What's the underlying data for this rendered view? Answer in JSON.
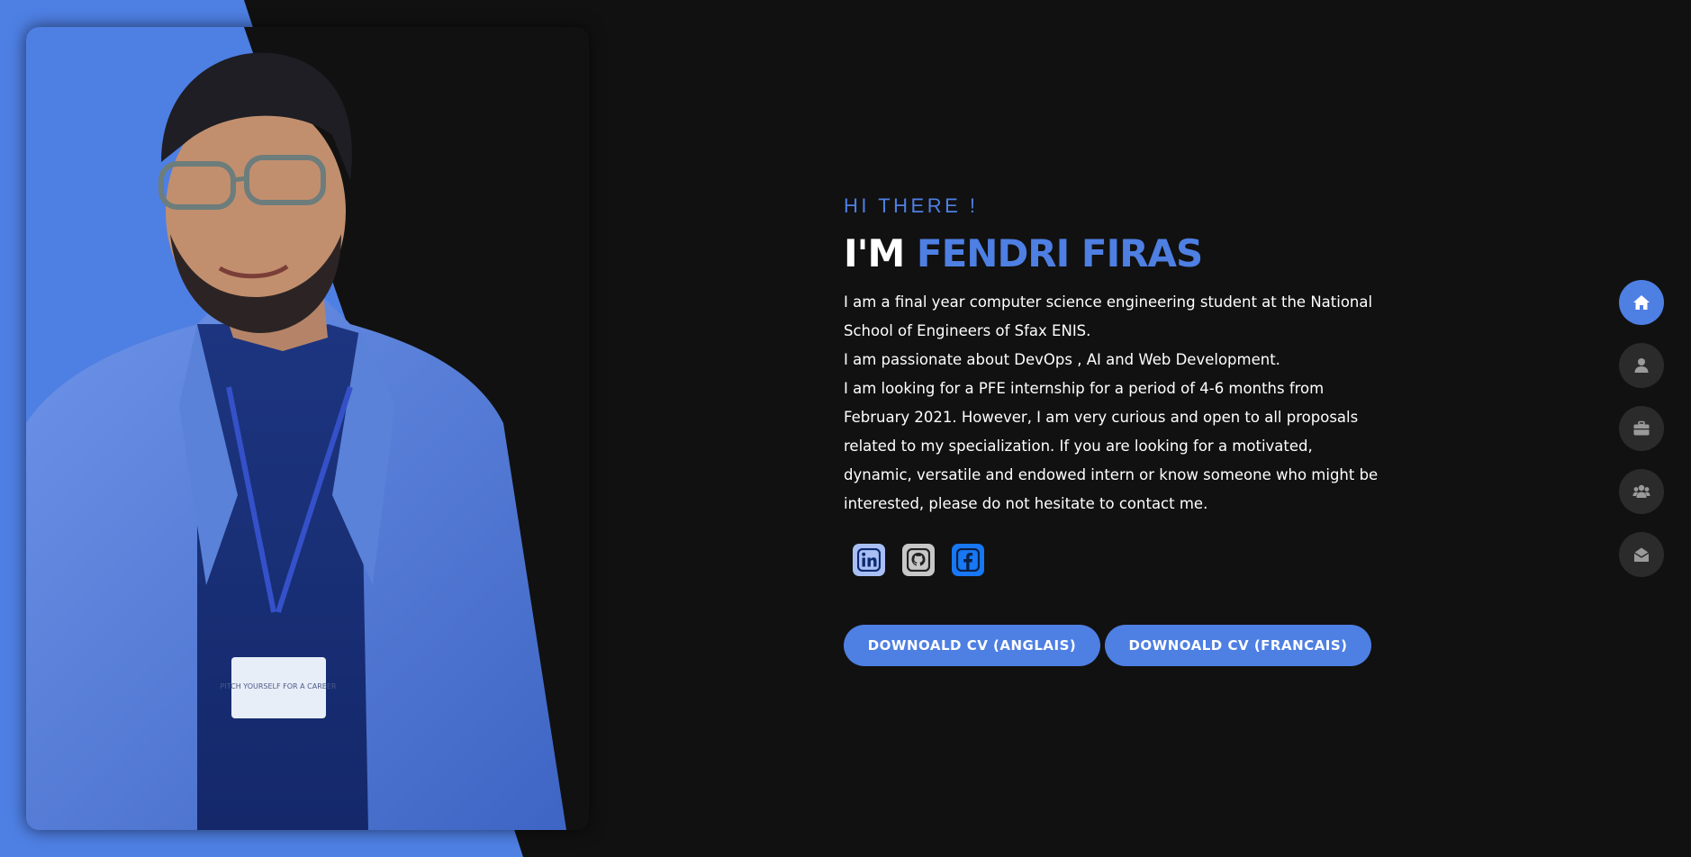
{
  "hero": {
    "greeting": "HI THERE !",
    "headline_prefix": "I'M ",
    "name": "FENDRI FIRAS",
    "bio": [
      "I am a final year computer science engineering student at the National School of Engineers of Sfax ENIS.",
      "I am passionate about DevOps , AI and Web Development.",
      "I am looking for a PFE internship for a period of 4-6 months from February 2021. However, I am very curious and open to all proposals related to my specialization. If you are looking for a motivated, dynamic, versatile and endowed intern or know someone who might be interested, please do not hesitate to contact me."
    ],
    "photo_badge_text": "PITCH YOURSELF FOR A CAREER"
  },
  "socials": [
    {
      "name": "linkedin",
      "icon": "linkedin-icon"
    },
    {
      "name": "github",
      "icon": "github-icon"
    },
    {
      "name": "facebook",
      "icon": "facebook-icon"
    }
  ],
  "buttons": {
    "cv_english": "DOWNOALD CV (ANGLAIS)",
    "cv_french": "DOWNOALD CV (FRANCAIS)"
  },
  "nav": [
    {
      "name": "home",
      "icon": "home-icon",
      "active": true
    },
    {
      "name": "about",
      "icon": "user-icon",
      "active": false
    },
    {
      "name": "portfolio",
      "icon": "briefcase-icon",
      "active": false
    },
    {
      "name": "team",
      "icon": "users-icon",
      "active": false
    },
    {
      "name": "contact",
      "icon": "envelope-open-icon",
      "active": false
    }
  ],
  "colors": {
    "accent": "#4e7fe3",
    "background": "#111111",
    "nav_inactive": "#2b2b2b"
  }
}
